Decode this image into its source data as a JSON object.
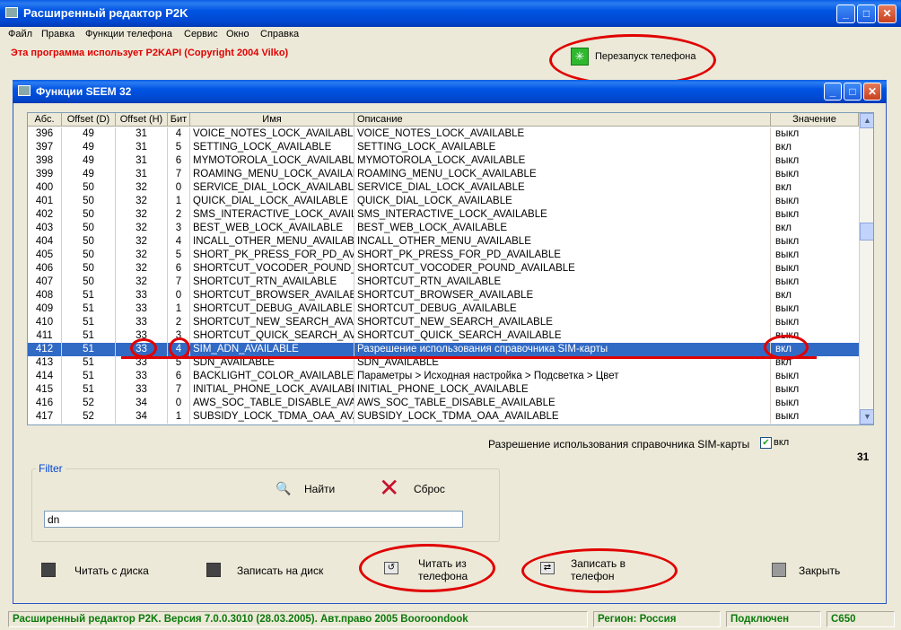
{
  "app": {
    "title": "Расширенный редактор P2K",
    "menu": [
      "Файл",
      "Правка",
      "Функции телефона",
      "Сервис",
      "Окно",
      "Справка"
    ],
    "notice": "Эта программа использует P2KAPI (Copyright 2004 Vilko)",
    "restart_label": "Перезапуск телефона"
  },
  "inner": {
    "title": "Функции SEEM 32",
    "columns": [
      "Абс.",
      "Offset (D)",
      "Offset (H)",
      "Бит",
      "Имя",
      "Описание",
      "Значение"
    ],
    "rows": [
      {
        "abs": "396",
        "od": "49",
        "oh": "31",
        "bit": "4",
        "name": "VOICE_NOTES_LOCK_AVAILABLE",
        "desc": "VOICE_NOTES_LOCK_AVAILABLE",
        "val": "выкл"
      },
      {
        "abs": "397",
        "od": "49",
        "oh": "31",
        "bit": "5",
        "name": "SETTING_LOCK_AVAILABLE",
        "desc": "SETTING_LOCK_AVAILABLE",
        "val": "вкл"
      },
      {
        "abs": "398",
        "od": "49",
        "oh": "31",
        "bit": "6",
        "name": "MYMOTOROLA_LOCK_AVAILABLE",
        "desc": "MYMOTOROLA_LOCK_AVAILABLE",
        "val": "выкл"
      },
      {
        "abs": "399",
        "od": "49",
        "oh": "31",
        "bit": "7",
        "name": "ROAMING_MENU_LOCK_AVAILABLE",
        "desc": "ROAMING_MENU_LOCK_AVAILABLE",
        "val": "выкл"
      },
      {
        "abs": "400",
        "od": "50",
        "oh": "32",
        "bit": "0",
        "name": "SERVICE_DIAL_LOCK_AVAILABLE",
        "desc": "SERVICE_DIAL_LOCK_AVAILABLE",
        "val": "вкл"
      },
      {
        "abs": "401",
        "od": "50",
        "oh": "32",
        "bit": "1",
        "name": "QUICK_DIAL_LOCK_AVAILABLE",
        "desc": "QUICK_DIAL_LOCK_AVAILABLE",
        "val": "выкл"
      },
      {
        "abs": "402",
        "od": "50",
        "oh": "32",
        "bit": "2",
        "name": "SMS_INTERACTIVE_LOCK_AVAILABLE",
        "desc": "SMS_INTERACTIVE_LOCK_AVAILABLE",
        "val": "выкл"
      },
      {
        "abs": "403",
        "od": "50",
        "oh": "32",
        "bit": "3",
        "name": "BEST_WEB_LOCK_AVAILABLE",
        "desc": "BEST_WEB_LOCK_AVAILABLE",
        "val": "вкл"
      },
      {
        "abs": "404",
        "od": "50",
        "oh": "32",
        "bit": "4",
        "name": "INCALL_OTHER_MENU_AVAILABLE",
        "desc": "INCALL_OTHER_MENU_AVAILABLE",
        "val": "выкл"
      },
      {
        "abs": "405",
        "od": "50",
        "oh": "32",
        "bit": "5",
        "name": "SHORT_PK_PRESS_FOR_PD_AVAILABLE",
        "desc": "SHORT_PK_PRESS_FOR_PD_AVAILABLE",
        "val": "выкл"
      },
      {
        "abs": "406",
        "od": "50",
        "oh": "32",
        "bit": "6",
        "name": "SHORTCUT_VOCODER_POUND_AVAILABLE",
        "desc": "SHORTCUT_VOCODER_POUND_AVAILABLE",
        "val": "выкл"
      },
      {
        "abs": "407",
        "od": "50",
        "oh": "32",
        "bit": "7",
        "name": "SHORTCUT_RTN_AVAILABLE",
        "desc": "SHORTCUT_RTN_AVAILABLE",
        "val": "выкл"
      },
      {
        "abs": "408",
        "od": "51",
        "oh": "33",
        "bit": "0",
        "name": "SHORTCUT_BROWSER_AVAILABLE",
        "desc": "SHORTCUT_BROWSER_AVAILABLE",
        "val": "вкл"
      },
      {
        "abs": "409",
        "od": "51",
        "oh": "33",
        "bit": "1",
        "name": "SHORTCUT_DEBUG_AVAILABLE",
        "desc": "SHORTCUT_DEBUG_AVAILABLE",
        "val": "выкл"
      },
      {
        "abs": "410",
        "od": "51",
        "oh": "33",
        "bit": "2",
        "name": "SHORTCUT_NEW_SEARCH_AVAILABLE",
        "desc": "SHORTCUT_NEW_SEARCH_AVAILABLE",
        "val": "выкл"
      },
      {
        "abs": "411",
        "od": "51",
        "oh": "33",
        "bit": "3",
        "name": "SHORTCUT_QUICK_SEARCH_AVAILABLE",
        "desc": "SHORTCUT_QUICK_SEARCH_AVAILABLE",
        "val": "выкл"
      },
      {
        "abs": "412",
        "od": "51",
        "oh": "33",
        "bit": "4",
        "name": "SIM_ADN_AVAILABLE",
        "desc": "Разрешение использования справочника SIM-карты",
        "val": "вкл",
        "selected": true
      },
      {
        "abs": "413",
        "od": "51",
        "oh": "33",
        "bit": "5",
        "name": "SDN_AVAILABLE",
        "desc": "SDN_AVAILABLE",
        "val": "вкл"
      },
      {
        "abs": "414",
        "od": "51",
        "oh": "33",
        "bit": "6",
        "name": "BACKLIGHT_COLOR_AVAILABLE",
        "desc": "Параметры > Исходная настройка > Подсветка > Цвет",
        "val": "выкл"
      },
      {
        "abs": "415",
        "od": "51",
        "oh": "33",
        "bit": "7",
        "name": "INITIAL_PHONE_LOCK_AVAILABLE",
        "desc": "INITIAL_PHONE_LOCK_AVAILABLE",
        "val": "выкл"
      },
      {
        "abs": "416",
        "od": "52",
        "oh": "34",
        "bit": "0",
        "name": "AWS_SOC_TABLE_DISABLE_AVAILABLE",
        "desc": "AWS_SOC_TABLE_DISABLE_AVAILABLE",
        "val": "выкл"
      },
      {
        "abs": "417",
        "od": "52",
        "oh": "34",
        "bit": "1",
        "name": "SUBSIDY_LOCK_TDMA_OAA_AVAILABLE",
        "desc": "SUBSIDY_LOCK_TDMA_OAA_AVAILABLE",
        "val": "выкл"
      }
    ],
    "selected_desc": "Разрешение использования справочника SIM-карты",
    "checkbox_label": "вкл",
    "offset_value": "31",
    "filter": {
      "label": "Filter",
      "find_label": "Найти",
      "reset_label": "Сброс",
      "value": "dn"
    },
    "actions": {
      "read_disk": "Читать с диска",
      "write_disk": "Записать на диск",
      "read_phone_1": "Читать из",
      "read_phone_2": "телефона",
      "write_phone_1": "Записать в",
      "write_phone_2": "телефон",
      "close": "Закрыть"
    }
  },
  "status": {
    "version": "Расширенный редактор P2K. Версия 7.0.0.3010 (28.03.2005). Авт.право 2005 Booroondook",
    "region": "Регион: Россия",
    "connection": "Подключен",
    "model": "C650"
  },
  "colors": {
    "title_blue": "#0054e3",
    "selection": "#316ac5",
    "notice_red": "#e00000",
    "status_green": "#0c7a0c"
  }
}
